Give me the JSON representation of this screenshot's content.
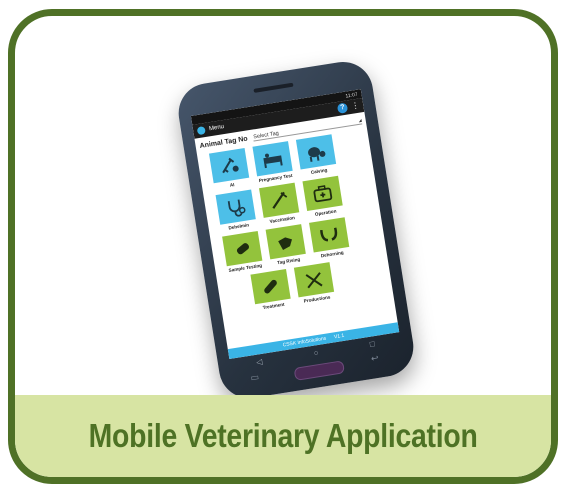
{
  "caption": "Mobile Veterinary Application",
  "phone": {
    "status_time": "11:07",
    "appbar": {
      "menu_label": "Menu",
      "help_label": "?",
      "overflow_label": "⋮"
    },
    "tag": {
      "label": "Animal Tag No",
      "select_placeholder": "Select Tag",
      "select_arrow": "◢"
    },
    "tiles": [
      {
        "label": "AI",
        "color": "blue",
        "icon": "syringe-icon"
      },
      {
        "label": "Pregnancy Test",
        "color": "blue",
        "icon": "cow-bed-icon"
      },
      {
        "label": "Calving",
        "color": "blue",
        "icon": "cow-calf-icon"
      },
      {
        "label": "Dehelmin",
        "color": "blue",
        "icon": "stethoscope-icon"
      },
      {
        "label": "Vaccination",
        "color": "green",
        "icon": "needle-icon"
      },
      {
        "label": "Operation",
        "color": "green",
        "icon": "medical-bag-icon"
      },
      {
        "label": "Sample Testing",
        "color": "green",
        "icon": "test-tube-icon"
      },
      {
        "label": "Tag Rising",
        "color": "green",
        "icon": "tag-icon"
      },
      {
        "label": "Dehorning",
        "color": "green",
        "icon": "horns-icon"
      },
      {
        "label": "Treatment",
        "color": "green",
        "icon": "bandage-icon"
      },
      {
        "label": "Productions",
        "color": "green",
        "icon": "tools-icon"
      }
    ],
    "footer": {
      "brand": "CSSK InfoSolutions",
      "version": "V1.1"
    },
    "softkeys": {
      "back": "◁",
      "home": "○",
      "recents": "□"
    },
    "hw_back": "↩",
    "hw_menu": "▭"
  },
  "colors": {
    "frame": "#4f7126",
    "band": "#d7e4a3",
    "caption": "#4e7225",
    "tile_blue": "#4dbfe8",
    "tile_green": "#93c33c"
  }
}
